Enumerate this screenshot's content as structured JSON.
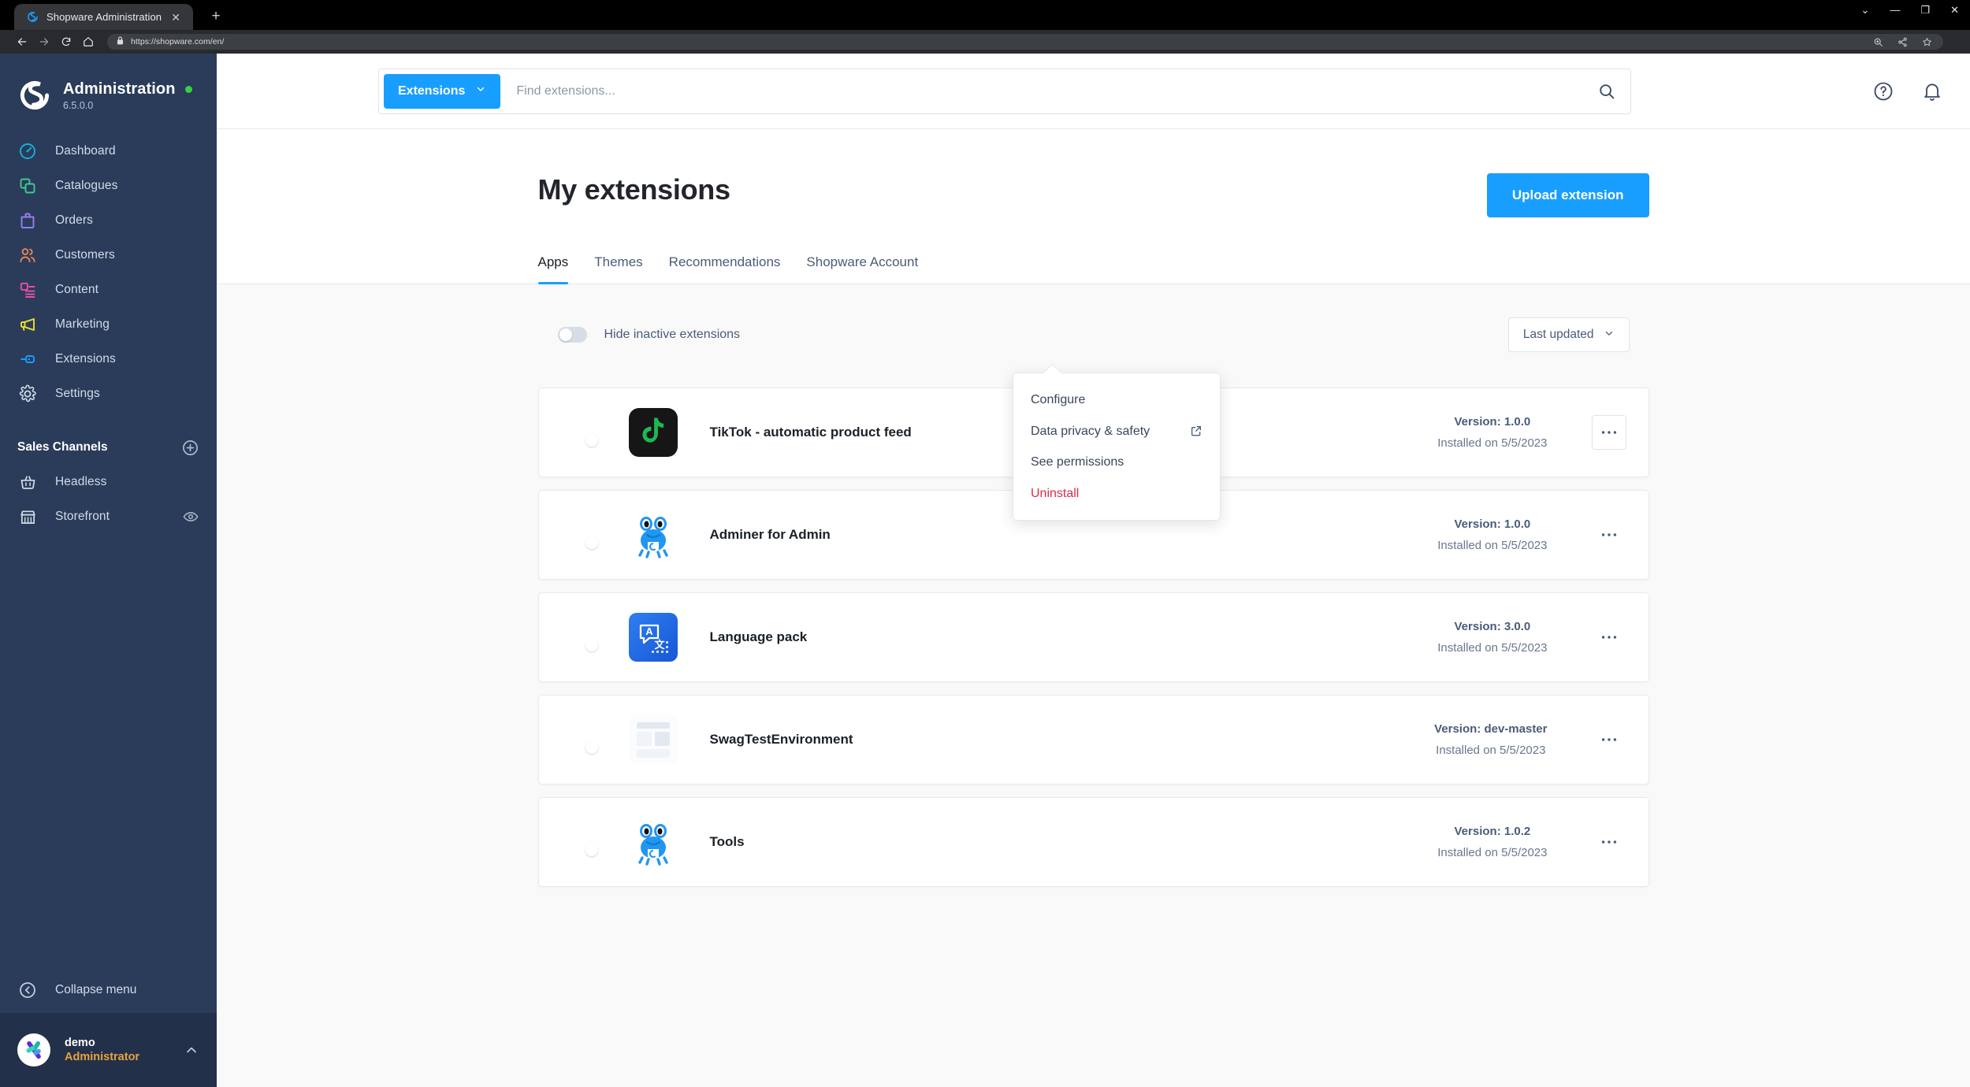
{
  "browser": {
    "tab_title": "Shopware Administration",
    "tab_close_glyph": "✕",
    "new_tab_glyph": "+",
    "url": "https://shopware.com/en/",
    "window_controls": {
      "minimize": "—",
      "restore": "❐",
      "close": "✕",
      "chevron": "⌄"
    }
  },
  "sidebar": {
    "brand": {
      "title": "Administration",
      "version": "6.5.0.0",
      "status_color": "#37d047"
    },
    "items": [
      {
        "label": "Dashboard",
        "icon": "dashboard-icon",
        "color": "#19afd6"
      },
      {
        "label": "Catalogues",
        "icon": "catalogues-icon",
        "color": "#3ecb8f"
      },
      {
        "label": "Orders",
        "icon": "orders-icon",
        "color": "#9a7df0"
      },
      {
        "label": "Customers",
        "icon": "customers-icon",
        "color": "#ec8257"
      },
      {
        "label": "Content",
        "icon": "content-icon",
        "color": "#ec4fa0"
      },
      {
        "label": "Marketing",
        "icon": "marketing-icon",
        "color": "#f0e025"
      },
      {
        "label": "Extensions",
        "icon": "extensions-icon",
        "color": "#189eff"
      },
      {
        "label": "Settings",
        "icon": "settings-icon",
        "color": "#d3dbe8"
      }
    ],
    "sales_channels": {
      "title": "Sales Channels",
      "add_label": "add-sales-channel",
      "items": [
        {
          "label": "Headless",
          "icon": "basket-icon"
        },
        {
          "label": "Storefront",
          "icon": "store-icon",
          "trailing_icon": "eye-icon"
        }
      ]
    },
    "collapse_label": "Collapse menu",
    "user": {
      "name": "demo",
      "role": "Administrator"
    }
  },
  "topbar": {
    "search_scope": "Extensions",
    "search_value": "",
    "search_placeholder": "Find extensions...",
    "help_icon": "help-icon",
    "notification_icon": "bell-icon"
  },
  "page": {
    "title": "My extensions",
    "upload_button": "Upload extension",
    "tabs": [
      {
        "label": "Apps",
        "active": true
      },
      {
        "label": "Themes",
        "active": false
      },
      {
        "label": "Recommendations",
        "active": false
      },
      {
        "label": "Shopware Account",
        "active": false
      }
    ],
    "filter": {
      "hide_inactive_label": "Hide inactive extensions",
      "hide_inactive_on": false,
      "sort_label": "Last updated"
    },
    "extensions": [
      {
        "name": "TikTok - automatic product feed",
        "version": "Version: 1.0.0",
        "installed": "Installed on 5/5/2023",
        "active": true,
        "icon": "tiktok-icon",
        "menu_open": true
      },
      {
        "name": "Adminer for Admin",
        "version": "Version: 1.0.0",
        "installed": "Installed on 5/5/2023",
        "active": true,
        "icon": "frog-icon",
        "menu_open": false
      },
      {
        "name": "Language pack",
        "version": "Version: 3.0.0",
        "installed": "Installed on 5/5/2023",
        "active": true,
        "icon": "language-icon",
        "menu_open": false
      },
      {
        "name": "SwagTestEnvironment",
        "version": "Version: dev-master",
        "installed": "Installed on 5/5/2023",
        "active": true,
        "icon": "placeholder-icon",
        "menu_open": false
      },
      {
        "name": "Tools",
        "version": "Version: 1.0.2",
        "installed": "Installed on 5/5/2023",
        "active": true,
        "icon": "frog-icon",
        "menu_open": false
      }
    ]
  },
  "context_menu": {
    "items": [
      {
        "label": "Configure",
        "danger": false,
        "external": false
      },
      {
        "label": "Data privacy & safety",
        "danger": false,
        "external": true
      },
      {
        "label": "See permissions",
        "danger": false,
        "external": false
      },
      {
        "label": "Uninstall",
        "danger": true,
        "external": false
      }
    ]
  },
  "colors": {
    "accent": "#189eff",
    "sidebar": "#2a3c5a",
    "danger": "#de294c",
    "warning": "#e8a33d"
  }
}
